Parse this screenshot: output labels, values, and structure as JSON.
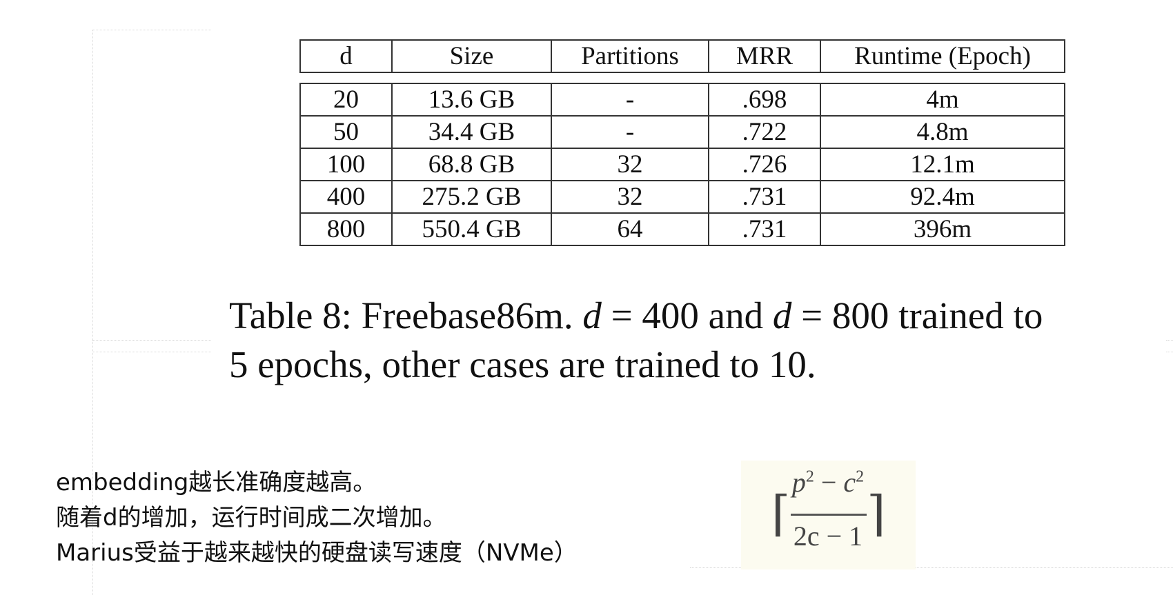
{
  "table": {
    "headers": [
      "d",
      "Size",
      "Partitions",
      "MRR",
      "Runtime (Epoch)"
    ],
    "rows": [
      [
        "20",
        "13.6 GB",
        "-",
        ".698",
        "4m"
      ],
      [
        "50",
        "34.4 GB",
        "-",
        ".722",
        "4.8m"
      ],
      [
        "100",
        "68.8 GB",
        "32",
        ".726",
        "12.1m"
      ],
      [
        "400",
        "275.2 GB",
        "32",
        ".731",
        "92.4m"
      ],
      [
        "800",
        "550.4 GB",
        "64",
        ".731",
        "396m"
      ]
    ]
  },
  "caption": {
    "prefix": "Table 8: Freebase86m.",
    "var1": "d",
    "eq1": " = 400 and ",
    "var2": "d",
    "eq2": " = 800 trained to",
    "line2": "5 epochs, other cases are trained to 10."
  },
  "notes": [
    "embedding越长准确度越高。",
    "随着d的增加，运行时间成二次增加。",
    "Marius受益于越来越快的硬盘读写速度（NVMe）"
  ],
  "formula": {
    "num_p": "p",
    "num_exp1": "2",
    "num_minus": " − ",
    "num_c": "c",
    "num_exp2": "2",
    "den": "2c − 1",
    "left": "⌈",
    "right": "⌉"
  }
}
